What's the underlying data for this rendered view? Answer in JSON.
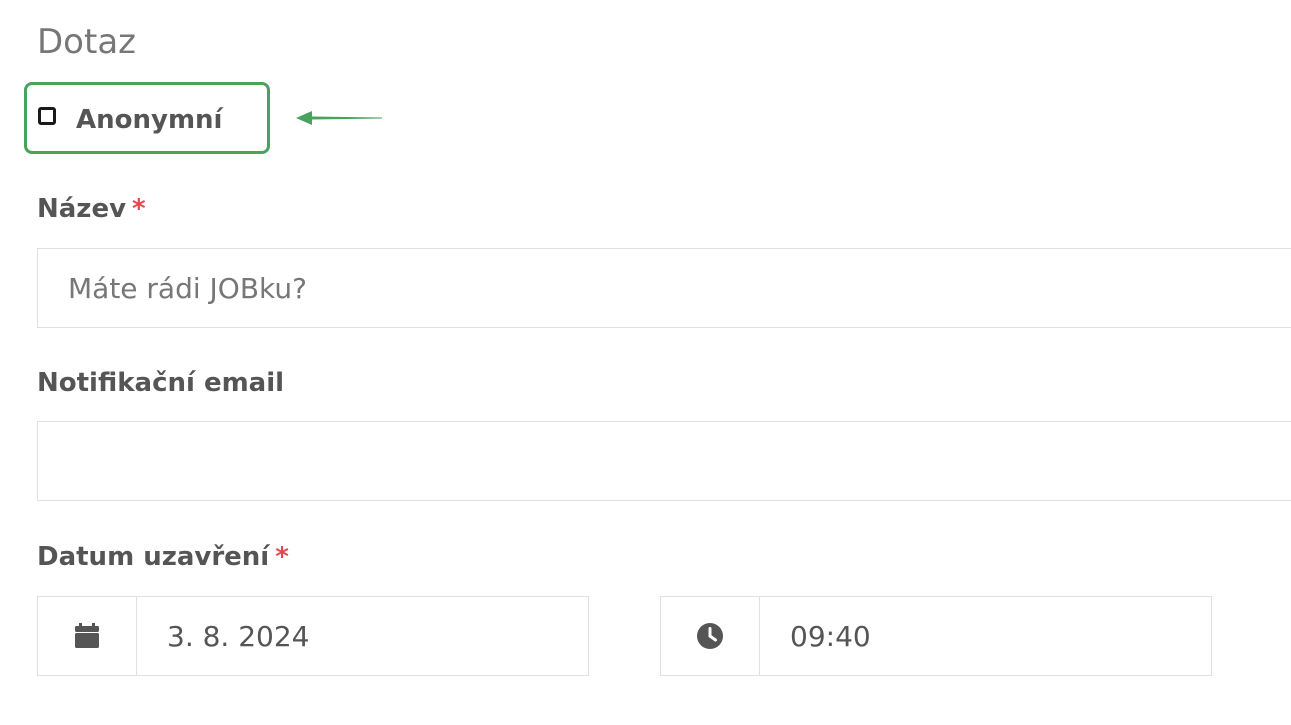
{
  "section": {
    "title": "Dotaz"
  },
  "anonymous": {
    "label": "Anonymní",
    "checked": false
  },
  "fields": {
    "name": {
      "label": "Název",
      "required_mark": "*",
      "placeholder": "Máte rádi JOBku?",
      "value": ""
    },
    "email": {
      "label": "Notifikační email",
      "placeholder": "",
      "value": ""
    },
    "close_date": {
      "label": "Datum uzavření",
      "required_mark": "*",
      "date_value": "3. 8. 2024",
      "time_value": "09:40"
    }
  },
  "icons": {
    "date": "calendar-icon",
    "time": "clock-icon",
    "annotation": "arrow-left-icon"
  },
  "colors": {
    "highlight": "#4aa35c",
    "required": "#e2484e",
    "border": "#e0e0e0",
    "text": "#555555"
  }
}
